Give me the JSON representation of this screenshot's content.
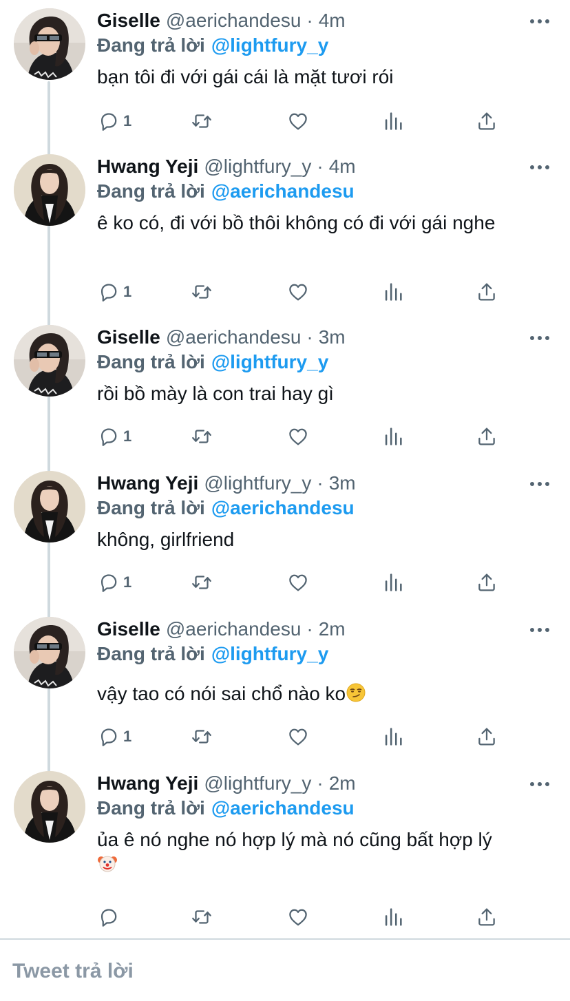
{
  "ui": {
    "accent": "#1d9bf0",
    "muted_text": "#536471",
    "composer_placeholder": "Tweet trả lời"
  },
  "tweets": [
    {
      "name": "Giselle",
      "handle": "@aerichandesu",
      "time": "4m",
      "replying_label": "Đang trả lời",
      "replying_to": "@lightfury_y",
      "text": "bạn tôi đi với gái cái là mặt tươi rói",
      "reply_count": "1",
      "avatar": "giselle-avatar"
    },
    {
      "name": "Hwang Yeji",
      "handle": "@lightfury_y",
      "time": "4m",
      "replying_label": "Đang trả lời",
      "replying_to": "@aerichandesu",
      "text": "ê ko có, đi với bồ thôi không có đi với gái nghe",
      "reply_count": "1",
      "avatar": "yeji-avatar"
    },
    {
      "name": "Giselle",
      "handle": "@aerichandesu",
      "time": "3m",
      "replying_label": "Đang trả lời",
      "replying_to": "@lightfury_y",
      "text": "rồi bồ mày là con trai hay gì",
      "reply_count": "1",
      "avatar": "giselle-avatar"
    },
    {
      "name": "Hwang Yeji",
      "handle": "@lightfury_y",
      "time": "3m",
      "replying_label": "Đang trả lời",
      "replying_to": "@aerichandesu",
      "text": "không, girlfriend",
      "reply_count": "1",
      "avatar": "yeji-avatar"
    },
    {
      "name": "Giselle",
      "handle": "@aerichandesu",
      "time": "2m",
      "replying_label": "Đang trả lời",
      "replying_to": "@lightfury_y",
      "text": "vậy tao có nói sai chổ nào ko",
      "emoji": "smirk-emoji",
      "reply_count": "1",
      "avatar": "giselle-avatar"
    },
    {
      "name": "Hwang Yeji",
      "handle": "@lightfury_y",
      "time": "2m",
      "replying_label": "Đang trả lời",
      "replying_to": "@aerichandesu",
      "text": "ủa ê nó nghe nó hợp lý mà nó cũng bất hợp lý",
      "emoji": "clown-emoji",
      "reply_count": "",
      "avatar": "yeji-avatar"
    }
  ]
}
